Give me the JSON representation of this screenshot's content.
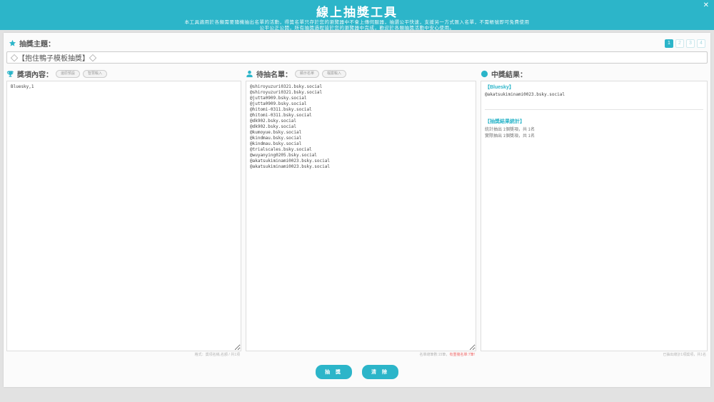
{
  "header": {
    "title": "線上抽獎工具",
    "subtitle_line1": "本工具適用於各類需要隨機抽出名單的活動，得獎名單只存於您的瀏覽器中不會上傳伺服器，抽選公平快速，支援另一方式匯入名單，不需帳號即可免費使用",
    "subtitle_line2": "公平公正公開，所有抽獎過程皆於您的瀏覽器中完成，歡迎於各類抽獎活動中安心使用。",
    "close_label": "✕"
  },
  "theme": {
    "label": "抽獎主題：",
    "value": "◇【抱住鴨子模板抽獎】◇",
    "tabs": [
      "1",
      "2",
      "3",
      "4"
    ],
    "active_tab": "1"
  },
  "prizes": {
    "label": "獎項內容：",
    "buttons": [
      "還原預設",
      "智慧輸入"
    ],
    "content": "Bluesky,1",
    "status": "格式：獎項名稱,名額 / 共1項"
  },
  "pool": {
    "label": "待抽名單：",
    "buttons": [
      "顯示名單",
      "檔案輸入"
    ],
    "names": [
      "@shiroyuzuri0321.bsky.social",
      "@shiroyuzuri0321.bsky.social",
      "@jutta0909.bsky.social",
      "@jutta0909.bsky.social",
      "@hitomi-0311.bsky.social",
      "@hitomi-0311.bsky.social",
      "@dk902.bsky.social",
      "@dk902.bsky.social",
      "@kumoyue.bsky.social",
      "@kindmau.bsky.social",
      "@kindmau.bsky.social",
      "@trialscales.bsky.social",
      "@wuyanying0205.bsky.social",
      "@akatsukiminami0023.bsky.social",
      "@akatsukiminami0023.bsky.social"
    ],
    "status_gray": "名單總筆數:15筆，",
    "status_red": "有重複名單:7筆!"
  },
  "results": {
    "label": "中獎結果：",
    "prize_title": "【Bluesky】",
    "winner": "@akatsukiminami0023.bsky.social",
    "summary_title": "【抽獎結果統計】",
    "summary_lines": [
      "統計抽出 1個獎項，共 1名",
      "實際抽出 1個獎項，共 1名"
    ],
    "status": "已抽出總計1項獎項，共1名"
  },
  "footer": {
    "draw_label": "抽 獎",
    "clear_label": "清 除"
  },
  "colors": {
    "accent": "#2cb5c9",
    "warning": "#f06a6a"
  }
}
